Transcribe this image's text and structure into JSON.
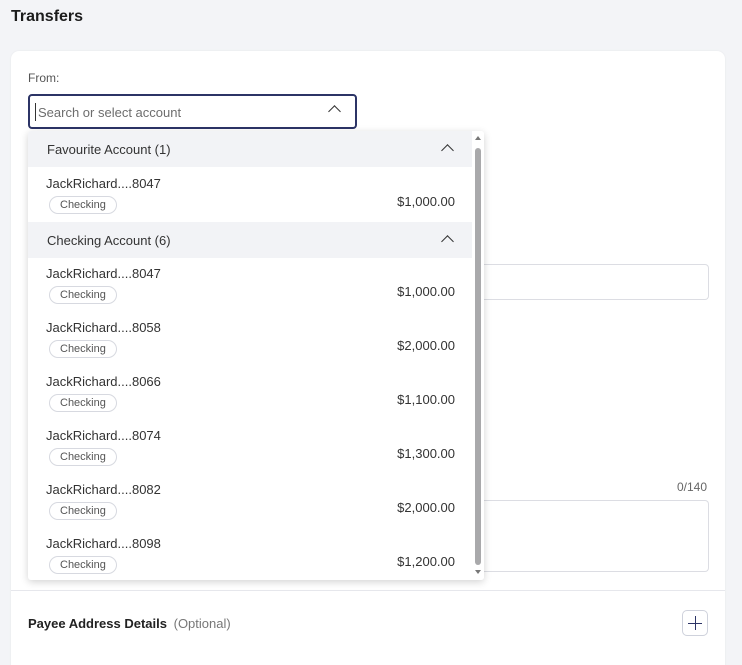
{
  "page": {
    "title": "Transfers"
  },
  "from": {
    "label": "From:",
    "placeholder": "Search or select account"
  },
  "form": {
    "char_counter": "0/140"
  },
  "payee": {
    "label": "Payee Address Details",
    "optional": "(Optional)"
  },
  "dropdown": {
    "groups": [
      {
        "label": "Favourite Account (1)",
        "accounts": [
          {
            "name": "JackRichard....8047",
            "type": "Checking",
            "amount": "$1,000.00"
          }
        ]
      },
      {
        "label": "Checking Account (6)",
        "accounts": [
          {
            "name": "JackRichard....8047",
            "type": "Checking",
            "amount": "$1,000.00"
          },
          {
            "name": "JackRichard....8058",
            "type": "Checking",
            "amount": "$2,000.00"
          },
          {
            "name": "JackRichard....8066",
            "type": "Checking",
            "amount": "$1,100.00"
          },
          {
            "name": "JackRichard....8074",
            "type": "Checking",
            "amount": "$1,300.00"
          },
          {
            "name": "JackRichard....8082",
            "type": "Checking",
            "amount": "$2,000.00"
          },
          {
            "name": "JackRichard....8098",
            "type": "Checking",
            "amount": "$1,200.00"
          }
        ]
      }
    ]
  },
  "colors": {
    "accent": "#2c3466",
    "background": "#f3f4f7",
    "group_header_bg": "#f2f3f6"
  },
  "icons": {
    "collapse": "chevron-up-icon",
    "add": "plus-icon"
  }
}
